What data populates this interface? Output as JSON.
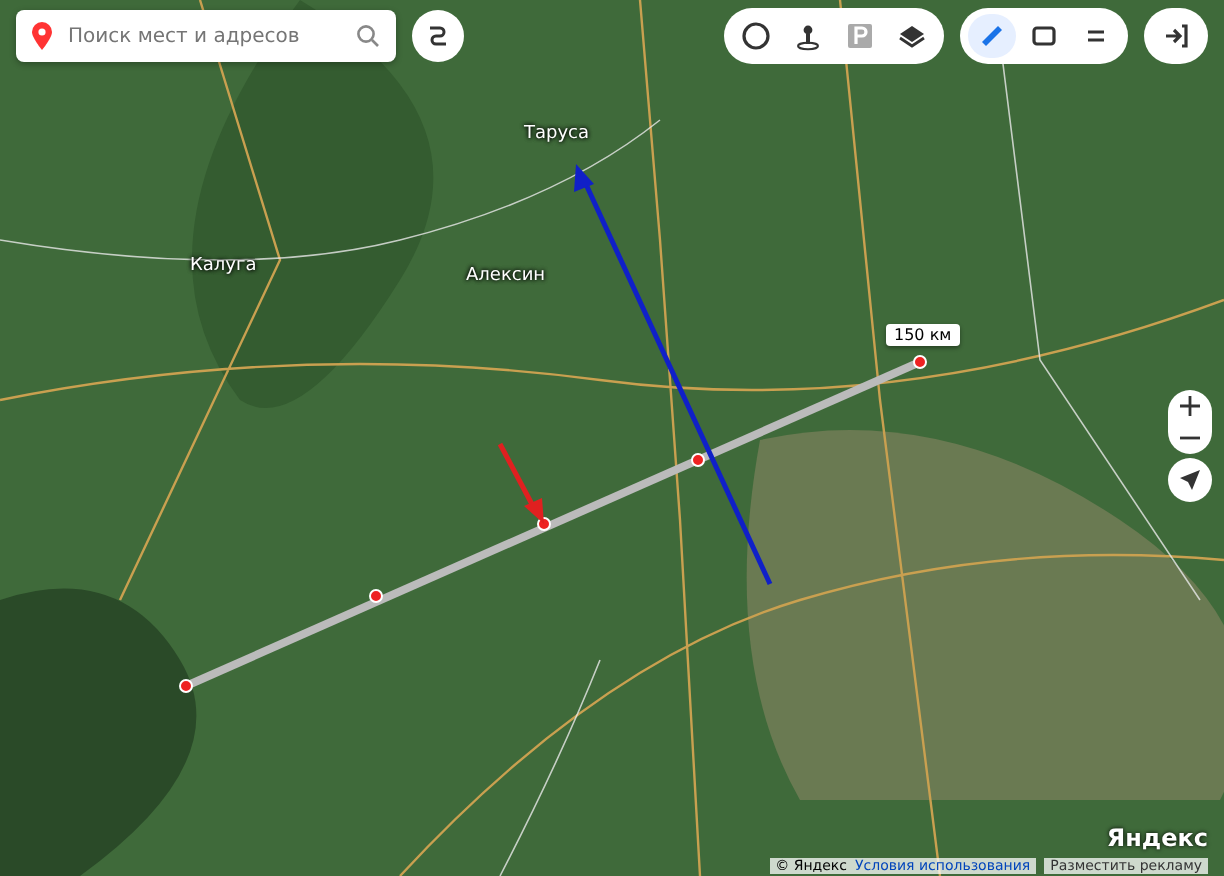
{
  "search": {
    "placeholder": "Поиск мест и адресов"
  },
  "toolbar": [
    {
      "kind": "traffic",
      "selected": false
    },
    {
      "kind": "panorama",
      "selected": false
    },
    {
      "kind": "parking",
      "selected": false
    },
    {
      "kind": "layers",
      "selected": false
    },
    {
      "kind": "ruler",
      "selected": true
    },
    {
      "kind": "print",
      "selected": false
    },
    {
      "kind": "menu",
      "selected": false
    },
    {
      "kind": "login",
      "selected": false
    }
  ],
  "ruler": {
    "label": "150 км"
  },
  "map_labels": [
    {
      "text": "Калуга"
    },
    {
      "text": "Таруса"
    },
    {
      "text": "Алексин"
    }
  ],
  "footer": {
    "copyright": "© Яндекс",
    "terms": "Условия использования",
    "ads": "Разместить рекламу",
    "logo": "Яндекс"
  }
}
